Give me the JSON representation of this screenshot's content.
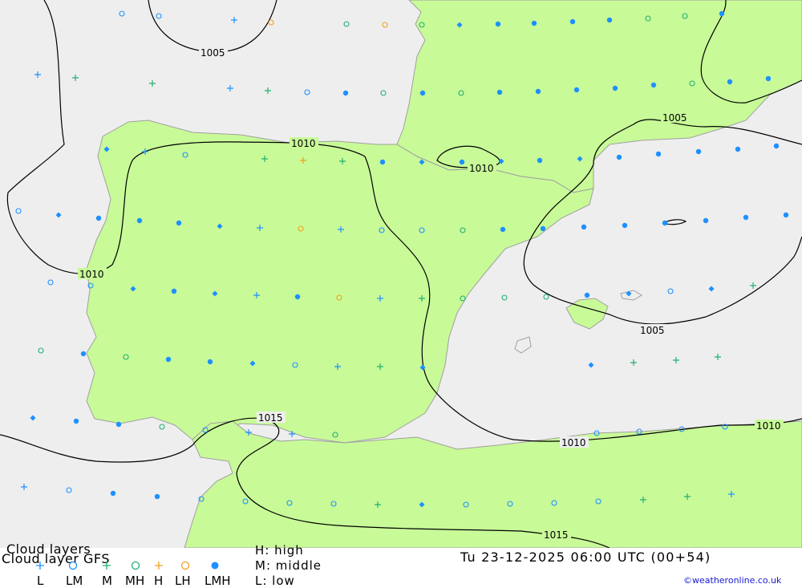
{
  "title_line1": "Cloud layers",
  "title_line2": "Cloud layer  GFS",
  "legend_codes": {
    "high": "H: high",
    "middle": "M: middle",
    "low": "L: low"
  },
  "legend_items": [
    {
      "label": "L",
      "symbol": "plus",
      "color": "#1e90ff"
    },
    {
      "label": "LM",
      "symbol": "circle",
      "color": "#1e90ff"
    },
    {
      "label": "M",
      "symbol": "plus",
      "color": "#20b070"
    },
    {
      "label": "MH",
      "symbol": "circle",
      "color": "#20b070"
    },
    {
      "label": "H",
      "symbol": "plus",
      "color": "#f0a020"
    },
    {
      "label": "LH",
      "symbol": "circle",
      "color": "#f0a020"
    },
    {
      "label": "LMH",
      "symbol": "dot",
      "color": "#1e90ff"
    }
  ],
  "datetime": "Tu 23-12-2025 06:00 UTC (00+54)",
  "copyright": "©weatheronline.co.uk",
  "isobar_labels": [
    "1005",
    "1010",
    "1010",
    "1010",
    "1005",
    "1005",
    "1015",
    "1010",
    "1010",
    "1015"
  ],
  "colors": {
    "land": "#c8fa98",
    "sea": "#eeeeee",
    "coast": "#a0a0a0",
    "isobar": "#000000"
  }
}
